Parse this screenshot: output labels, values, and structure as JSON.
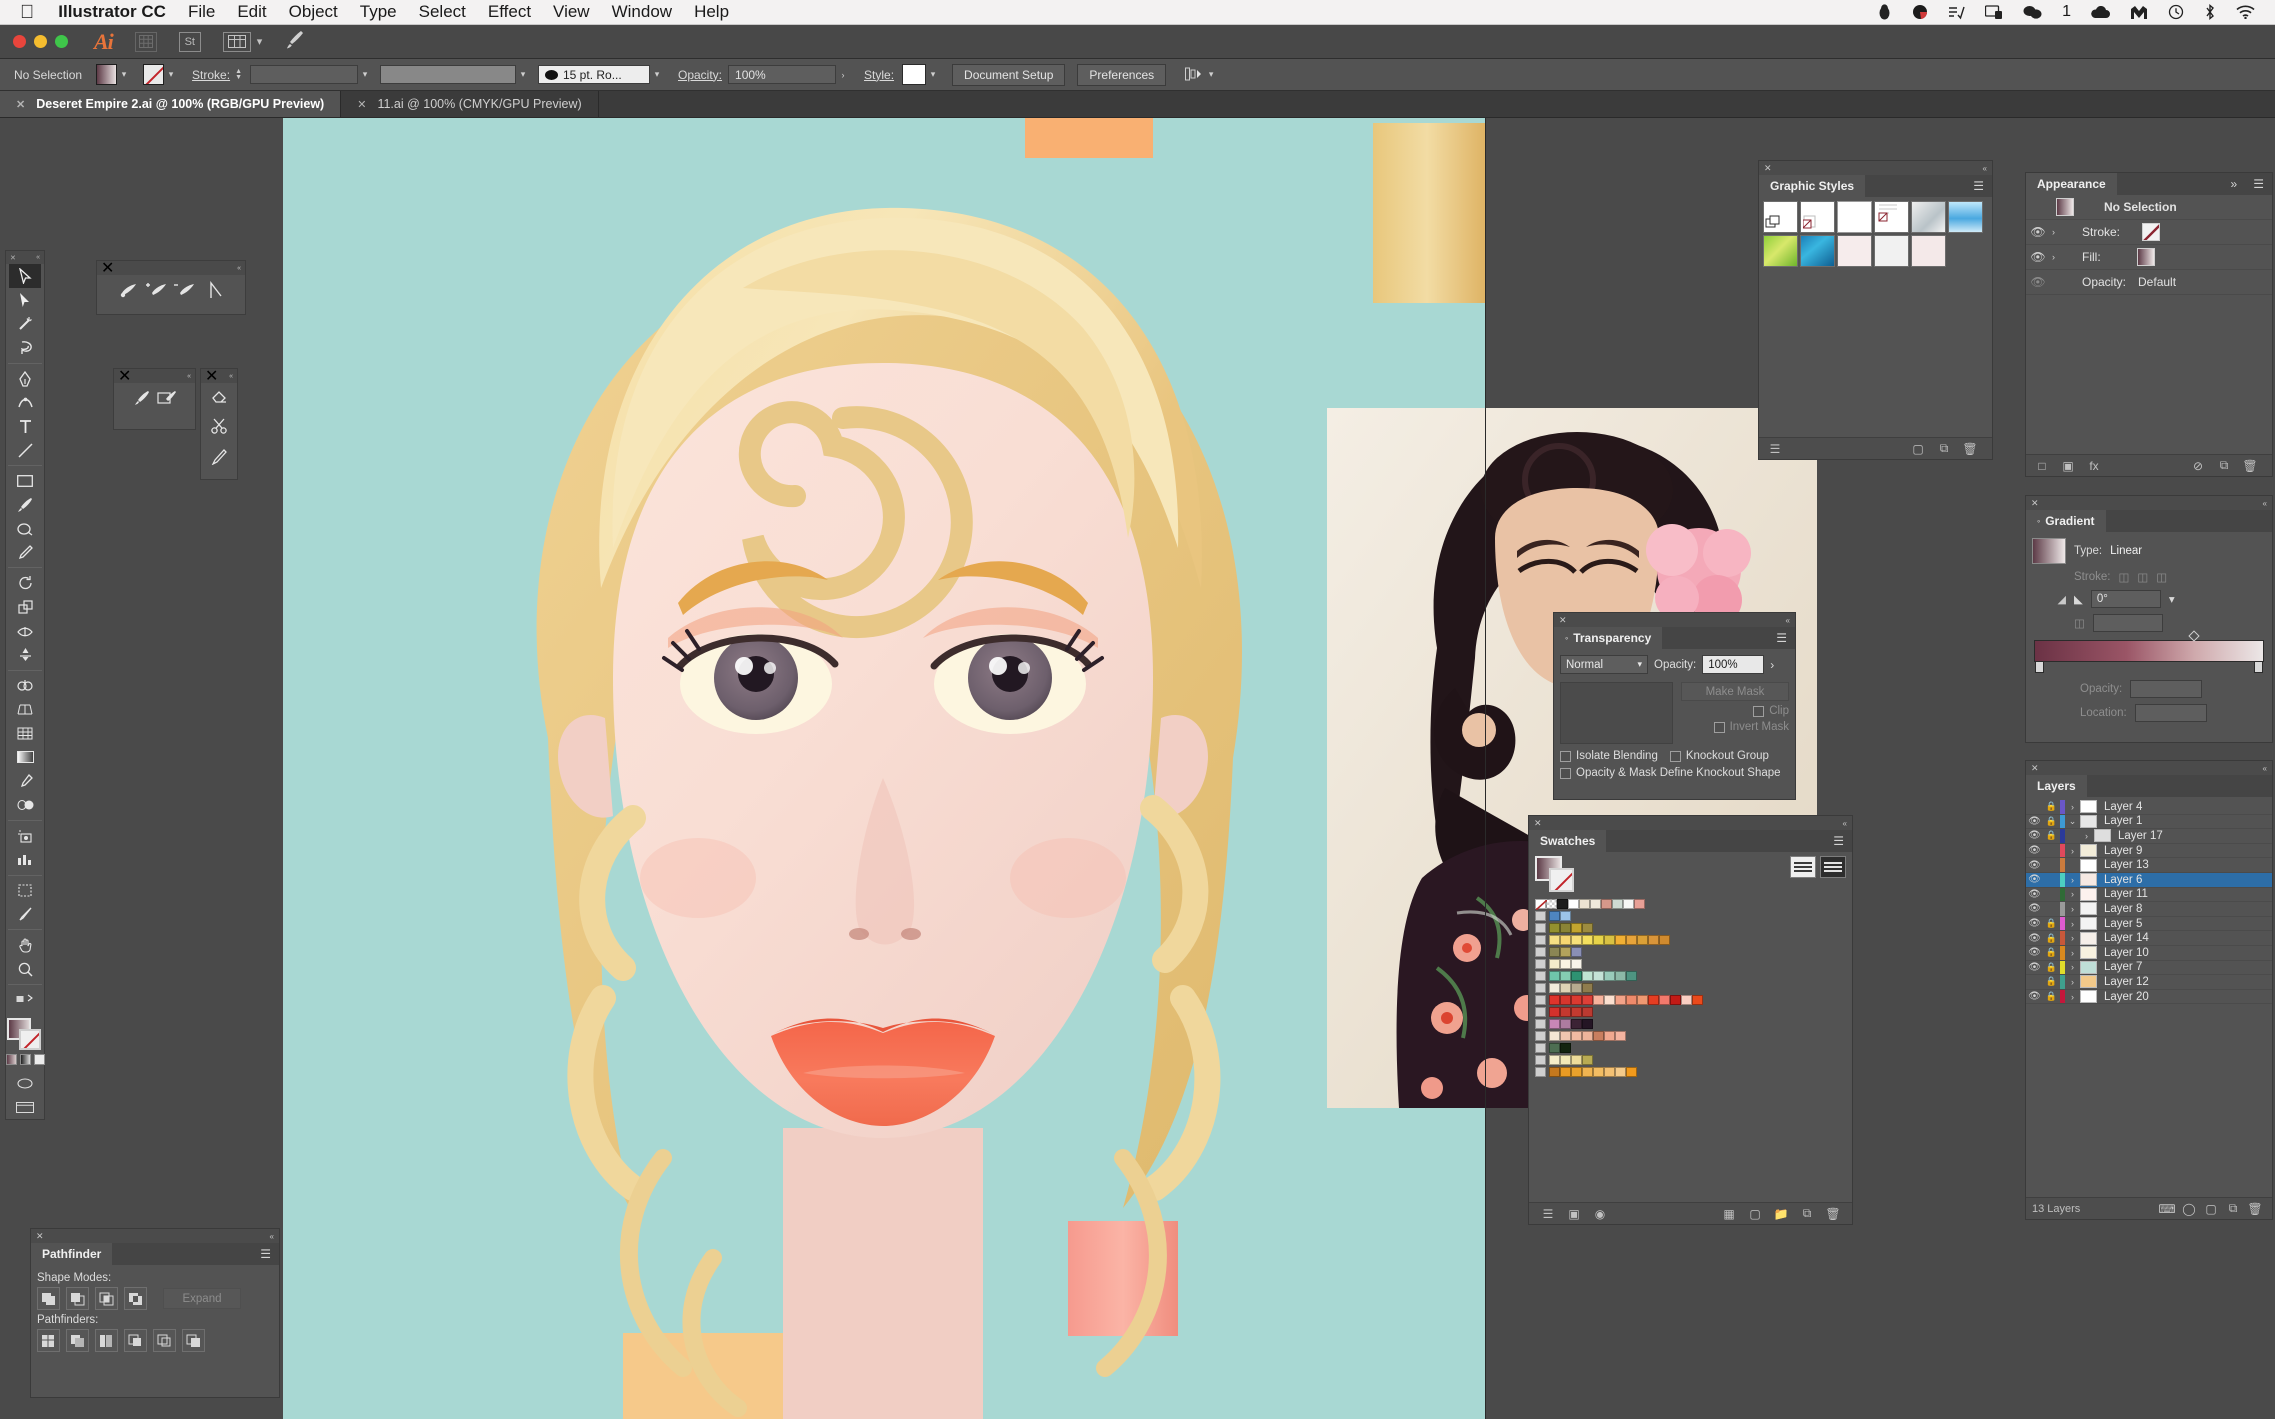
{
  "macmenu": {
    "apple_icon": "apple-icon",
    "items": [
      {
        "label": "Illustrator CC",
        "bold": true
      },
      {
        "label": "File",
        "bold": false
      },
      {
        "label": "Edit",
        "bold": false
      },
      {
        "label": "Object",
        "bold": false
      },
      {
        "label": "Type",
        "bold": false
      },
      {
        "label": "Select",
        "bold": false
      },
      {
        "label": "Effect",
        "bold": false
      },
      {
        "label": "View",
        "bold": false
      },
      {
        "label": "Window",
        "bold": false
      },
      {
        "label": "Help",
        "bold": false
      }
    ],
    "status_icons": [
      "penguin-icon",
      "record-icon",
      "list-check-icon",
      "screen-lock-icon",
      "wechat-icon",
      "cloud-icon",
      "mailbox-icon",
      "clock-icon",
      "bluetooth-icon",
      "wifi-icon"
    ],
    "notification_count": "1"
  },
  "appbar": {
    "logo": "Ai",
    "icons": [
      "bridge-icon",
      "stock-icon",
      "arrange-documents-icon",
      "chevron-down-icon",
      "brush-icon"
    ]
  },
  "control_bar": {
    "selection_state": "No Selection",
    "fill_label": "fill-swatch",
    "stroke_label": "stroke-swatch",
    "stroke_text": "Stroke:",
    "stroke_weight": "",
    "stroke_profile": "",
    "brush_definition": "15 pt. Ro...",
    "opacity_label": "Opacity:",
    "opacity_value": "100%",
    "style_label": "Style:",
    "document_setup": "Document Setup",
    "preferences": "Preferences"
  },
  "tabs": [
    {
      "title": "Deseret Empire 2.ai @ 100% (RGB/GPU Preview)",
      "active": true
    },
    {
      "title": "11.ai @ 100% (CMYK/GPU Preview)",
      "active": false
    }
  ],
  "graphic_styles": {
    "title": "Graphic Styles",
    "swatch_count": 11
  },
  "appearance": {
    "title": "Appearance",
    "selection": "No Selection",
    "rows": [
      {
        "label": "Stroke:",
        "kind": "stroke"
      },
      {
        "label": "Fill:",
        "kind": "fill"
      }
    ],
    "opacity_label": "Opacity:",
    "opacity_value": "Default"
  },
  "gradient": {
    "title": "Gradient",
    "type_label": "Type:",
    "type_value": "Linear",
    "stroke_label": "Stroke:",
    "angle_value": "0°",
    "opacity_label": "Opacity:",
    "opacity_value": "",
    "location_label": "Location:",
    "location_value": ""
  },
  "transparency": {
    "title": "Transparency",
    "blend_mode": "Normal",
    "opacity_label": "Opacity:",
    "opacity_value": "100%",
    "make_mask": "Make Mask",
    "clip": "Clip",
    "invert_mask": "Invert Mask",
    "isolate_blending": "Isolate Blending",
    "knockout_group": "Knockout Group",
    "opacity_mask_knockout": "Opacity & Mask Define Knockout Shape"
  },
  "swatches": {
    "title": "Swatches",
    "rows": [
      {
        "group": false,
        "colors": [
          "none",
          "registration",
          "#1c1c1c",
          "#ffffff",
          "#ece3d2",
          "#efe9dc",
          "#d6988a",
          "#cfdad2",
          "#f7f7f5",
          "#e8a096"
        ]
      },
      {
        "group": true,
        "colors": [
          "#4e85c0",
          "#9cc4e8"
        ]
      },
      {
        "group": true,
        "colors": [
          "#93902f",
          "#8a8436",
          "#c3a52f",
          "#9d8c3f"
        ]
      },
      {
        "group": true,
        "colors": [
          "#f5df84",
          "#f6d772",
          "#f7e07a",
          "#f4e05f",
          "#e7d44a",
          "#d9c143",
          "#f2b034",
          "#e8a43a",
          "#dba037",
          "#d9953a",
          "#d08a2e"
        ]
      },
      {
        "group": true,
        "colors": [
          "#8b8654",
          "#b3a35c",
          "#8a8fb5"
        ]
      },
      {
        "group": true,
        "colors": [
          "#f3ebcb",
          "#faf3e3",
          "#f8f4ea"
        ]
      },
      {
        "group": true,
        "colors": [
          "#6fc5ac",
          "#85cdb2",
          "#2e9272",
          "#bfe4d2",
          "#c4e2d6",
          "#99cbba",
          "#8cb9a7",
          "#4e9481"
        ]
      },
      {
        "group": true,
        "colors": [
          "#f3ecdc",
          "#ded3b5",
          "#b6ab8f",
          "#8f7c4d"
        ]
      },
      {
        "group": true,
        "colors": [
          "#e0342c",
          "#d7362e",
          "#db3a31",
          "#df4038",
          "#f7b39d",
          "#fbe0d0",
          "#f3a389",
          "#ef8a6b",
          "#f09972",
          "#e53d22",
          "#f2796c",
          "#c21a16",
          "#fbcfc3",
          "#eb4a1c"
        ]
      },
      {
        "group": true,
        "colors": [
          "#d3312c",
          "#c4382f",
          "#c33a30",
          "#bb3a31"
        ]
      },
      {
        "group": true,
        "colors": [
          "#c886b6",
          "#ae7ca0",
          "#3c2335",
          "#241524"
        ]
      },
      {
        "group": true,
        "colors": [
          "#f3e6d4",
          "#efc5af",
          "#f0baa2",
          "#edb49b",
          "#c87e5f",
          "#f0a88f",
          "#f4b4a0"
        ]
      },
      {
        "group": true,
        "colors": [
          "#4d6e52",
          "#13240f"
        ]
      },
      {
        "group": true,
        "colors": [
          "#f5edc8",
          "#f2e9b6",
          "#eddc9a",
          "#b9ab53"
        ]
      },
      {
        "group": true,
        "colors": [
          "#c4781e",
          "#e99b23",
          "#eaa22c",
          "#f0b451",
          "#f3bd63",
          "#f4c173",
          "#f5cb8b",
          "#f29a1c"
        ]
      }
    ]
  },
  "layers": {
    "title": "Layers",
    "count_label": "13 Layers",
    "rows": [
      {
        "name": "Layer 4",
        "visible": false,
        "locked": true,
        "color": "#6a57c7",
        "indent": 0,
        "twist": "›",
        "selected": false,
        "thumb": "#ffffff"
      },
      {
        "name": "Layer 1",
        "visible": true,
        "locked": true,
        "color": "#3d9ad4",
        "indent": 0,
        "twist": "⌄",
        "selected": false,
        "thumb": "#e7e7e7"
      },
      {
        "name": "Layer 17",
        "visible": true,
        "locked": true,
        "color": "#2b3a99",
        "indent": 1,
        "twist": "›",
        "selected": false,
        "thumb": "#dedede"
      },
      {
        "name": "Layer 9",
        "visible": true,
        "locked": false,
        "color": "#e0495c",
        "indent": 0,
        "twist": "›",
        "selected": false,
        "thumb": "#f2ecd9"
      },
      {
        "name": "Layer 13",
        "visible": true,
        "locked": false,
        "color": "#cb7b3d",
        "indent": 0,
        "twist": "",
        "selected": false,
        "thumb": "#ffffff"
      },
      {
        "name": "Layer 6",
        "visible": true,
        "locked": false,
        "color": "#4ccfc0",
        "indent": 0,
        "twist": "›",
        "selected": true,
        "thumb": "#f6e9e3"
      },
      {
        "name": "Layer 11",
        "visible": true,
        "locked": false,
        "color": "#2f6b36",
        "indent": 0,
        "twist": "›",
        "selected": false,
        "thumb": "#fdf2ee"
      },
      {
        "name": "Layer 8",
        "visible": true,
        "locked": false,
        "color": "#9a9a9a",
        "indent": 0,
        "twist": "›",
        "selected": false,
        "thumb": "#f3f3f3"
      },
      {
        "name": "Layer 5",
        "visible": true,
        "locked": true,
        "color": "#e05bd0",
        "indent": 0,
        "twist": "›",
        "selected": false,
        "thumb": "#f4f4f4"
      },
      {
        "name": "Layer 14",
        "visible": true,
        "locked": true,
        "color": "#c7583a",
        "indent": 0,
        "twist": "›",
        "selected": false,
        "thumb": "#f6efe9"
      },
      {
        "name": "Layer 10",
        "visible": true,
        "locked": true,
        "color": "#d7891f",
        "indent": 0,
        "twist": "›",
        "selected": false,
        "thumb": "#f8f2e0"
      },
      {
        "name": "Layer 7",
        "visible": true,
        "locked": true,
        "color": "#e0dd2b",
        "indent": 0,
        "twist": "›",
        "selected": false,
        "thumb": "#bfded7"
      },
      {
        "name": "Layer 12",
        "visible": false,
        "locked": true,
        "color": "#3fa08e",
        "indent": 0,
        "twist": "›",
        "selected": false,
        "thumb": "#f2c98a"
      },
      {
        "name": "Layer 20",
        "visible": true,
        "locked": true,
        "color": "#c4173b",
        "indent": 0,
        "twist": "›",
        "selected": false,
        "thumb": "#ffffff"
      }
    ]
  },
  "pathfinder": {
    "title": "Pathfinder",
    "shape_modes_label": "Shape Modes:",
    "pathfinders_label": "Pathfinders:",
    "expand_label": "Expand",
    "shape_mode_buttons": [
      "unite-icon",
      "minus-front-icon",
      "intersect-icon",
      "exclude-icon"
    ],
    "pathfinder_buttons": [
      "divide-icon",
      "trim-icon",
      "merge-icon",
      "crop-icon",
      "outline-icon",
      "minus-back-icon"
    ]
  },
  "mini_panels": {
    "symbols": [
      "symbol-sprayer-icon",
      "symbol-shifter-icon",
      "symbol-scruncher-icon",
      "symbol-path-icon"
    ],
    "brushes": [
      "paintbrush-icon",
      "blob-brush-icon"
    ],
    "eraser_tools": [
      "eraser-icon",
      "scissors-icon",
      "knife-icon"
    ]
  },
  "tools": [
    "selection-tool",
    "direct-selection-tool",
    "magic-wand-tool",
    "lasso-tool",
    "pen-tool",
    "curvature-tool",
    "type-tool",
    "line-segment-tool",
    "rectangle-tool",
    "paintbrush-tool",
    "shaper-tool",
    "pencil-tool",
    "rotate-tool",
    "scale-tool",
    "width-tool",
    "free-transform-tool",
    "shape-builder-tool",
    "perspective-grid-tool",
    "mesh-tool",
    "gradient-tool",
    "eyedropper-tool",
    "blend-tool",
    "symbol-sprayer-tool",
    "column-graph-tool",
    "artboard-tool",
    "slice-tool",
    "hand-tool",
    "zoom-tool"
  ],
  "canvas": {
    "artwork_title": "stylized-portrait-illustration",
    "background_color": "#a8d8d3",
    "reference_photo": "pinup-model-reference-photo",
    "zoom_level": "100%"
  },
  "colors": {
    "panel_bg": "#535353",
    "app_bg": "#3b3b3b",
    "canvas_bg": "#4a4a4a",
    "accent_selected": "#2d6ea8",
    "artboard_teal": "#a8d8d3"
  }
}
